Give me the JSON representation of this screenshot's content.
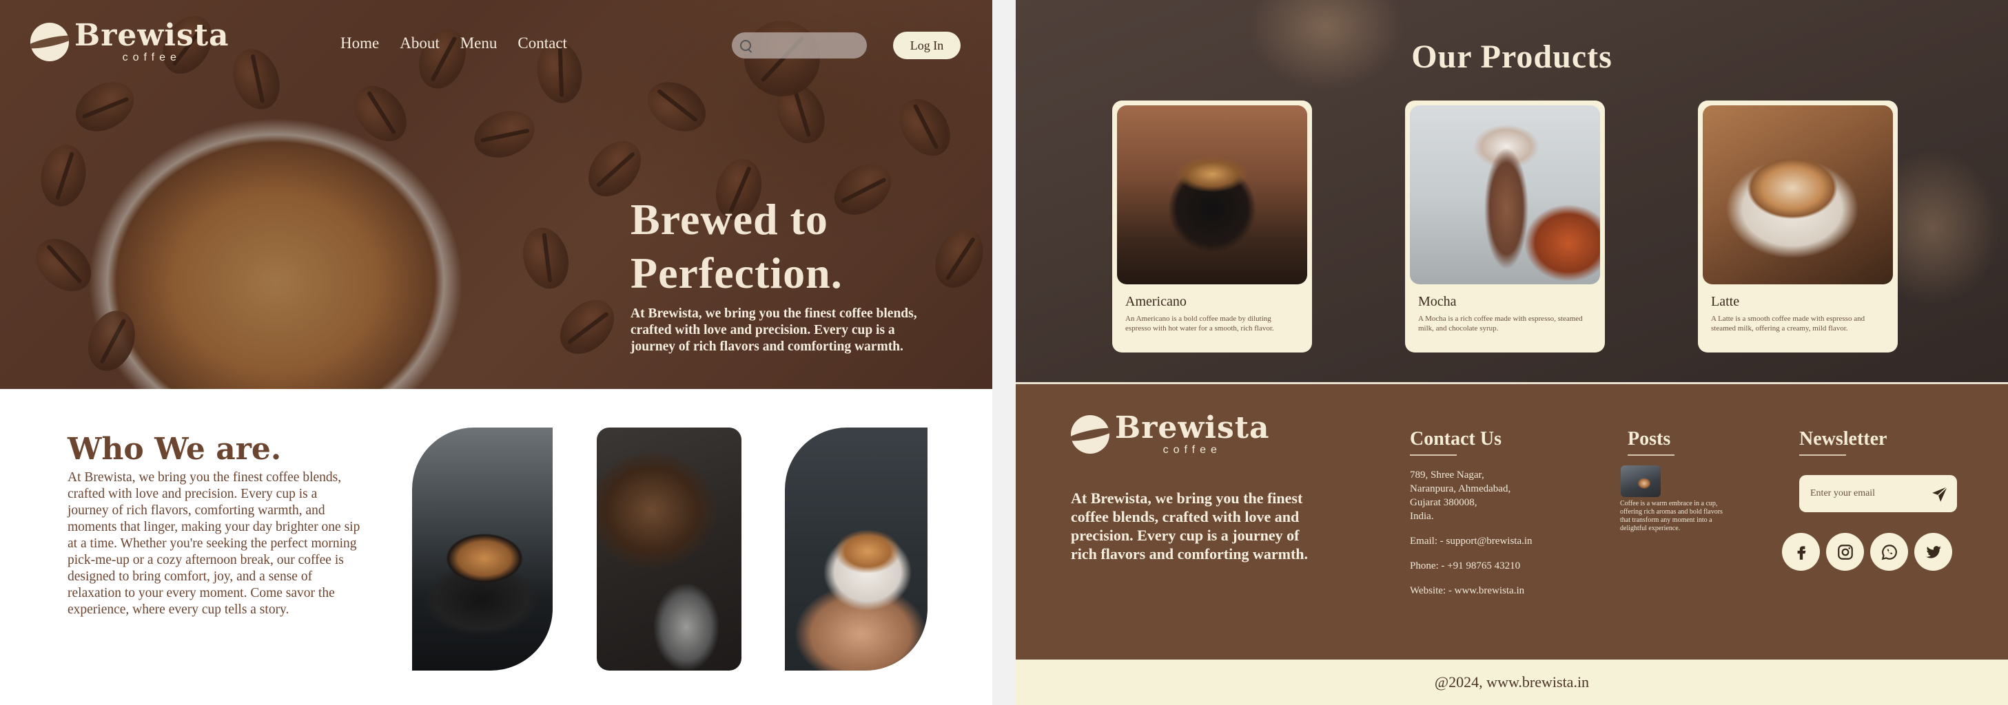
{
  "header": {
    "logo_word": "Brewista",
    "logo_sub": "coffee",
    "nav": [
      "Home",
      "About",
      "Menu",
      "Contact"
    ],
    "search_placeholder": "",
    "login_label": "Log In"
  },
  "hero": {
    "title_line1": "Brewed to",
    "title_line2": "Perfection.",
    "text": "At Brewista, we bring you the finest coffee blends, crafted with love and precision. Every cup is a journey of rich flavors and comforting warmth."
  },
  "about": {
    "title": "Who We  are.",
    "text": "At Brewista, we bring you the finest coffee blends, crafted with love and precision. Every cup is a journey of rich flavors, comforting warmth, and moments that linger, making your day brighter one sip at a time. Whether you're seeking the perfect morning pick-me-up or a cozy afternoon break, our coffee is designed to bring comfort, joy, and a sense of relaxation to your every moment. Come savor the experience, where every cup tells a story."
  },
  "products": {
    "title": "Our Products",
    "items": [
      {
        "name": "Americano",
        "desc": "An Americano is a bold coffee made by diluting espresso with hot water for a smooth, rich flavor."
      },
      {
        "name": "Mocha",
        "desc": "A Mocha is a rich coffee made with espresso, steamed milk, and chocolate syrup."
      },
      {
        "name": "Latte",
        "desc": "A Latte is a smooth coffee made with espresso and steamed milk, offering a creamy, mild flavor."
      }
    ]
  },
  "footer": {
    "logo_word": "Brewista",
    "logo_sub": "coffee",
    "text": "At Brewista, we bring you the finest coffee blends, crafted with love and precision. Every cup is a journey of rich flavors and comforting warmth.",
    "contact_title": "Contact Us",
    "address": [
      "789, Shree Nagar,",
      "Naranpura, Ahmedabad,",
      "Gujarat 380008,",
      "India."
    ],
    "email": "Email: - support@brewista.in",
    "phone": "Phone: - +91 98765 43210",
    "website": "Website: - www.brewista.in",
    "posts_title": "Posts",
    "post_text": "Coffee is a warm embrace in a cup, offering rich aromas and bold flavors that transform any moment into a delightful experience.",
    "newsletter_title": "Newsletter",
    "newsletter_placeholder": "Enter your email",
    "socials": [
      "facebook-icon",
      "instagram-icon",
      "whatsapp-icon",
      "twitter-icon"
    ],
    "copyright": "@2024, www.brewista.in"
  },
  "colors": {
    "brown": "#6d4b35",
    "cream": "#f6f1d8",
    "heading_brown": "#6b4530"
  }
}
